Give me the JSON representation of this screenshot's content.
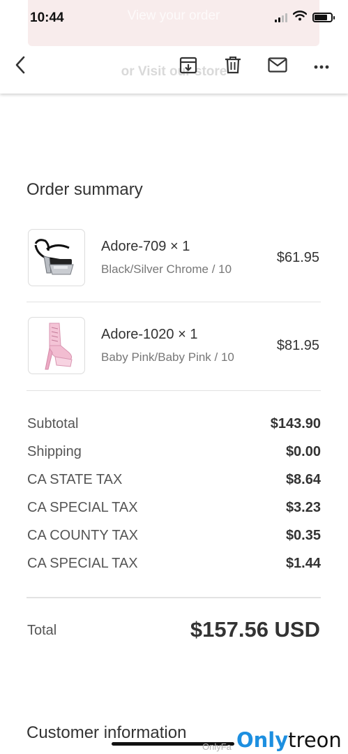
{
  "status_bar": {
    "time": "10:44"
  },
  "overlay": {
    "banner_text": "View your order",
    "ghost_link_text": "or Visit our store"
  },
  "toolbar": {
    "back_icon": "chevron-left-icon",
    "archive_icon": "archive-icon",
    "delete_icon": "trash-icon",
    "mail_icon": "mail-icon",
    "more_icon": "more-icon"
  },
  "order_summary": {
    "title": "Order summary",
    "items": [
      {
        "name": "Adore-709 × 1",
        "variant": "Black/Silver Chrome / 10",
        "price": "$61.95"
      },
      {
        "name": "Adore-1020 × 1",
        "variant": "Baby Pink/Baby Pink / 10",
        "price": "$81.95"
      }
    ],
    "lines": [
      {
        "label": "Subtotal",
        "value": "$143.90"
      },
      {
        "label": "Shipping",
        "value": "$0.00"
      },
      {
        "label": "CA STATE TAX",
        "value": "$8.64"
      },
      {
        "label": "CA SPECIAL TAX",
        "value": "$3.23"
      },
      {
        "label": "CA COUNTY TAX",
        "value": "$0.35"
      },
      {
        "label": "CA SPECIAL TAX",
        "value": "$1.44"
      }
    ],
    "total_label": "Total",
    "total_value": "$157.56 USD"
  },
  "customer_information": {
    "title": "Customer information"
  },
  "watermark": {
    "small": "OnlyFa",
    "brand_a": "Only",
    "brand_b": "treon"
  },
  "colors": {
    "banner": "#f8ecec",
    "brand_blue": "#1d8fe0",
    "divider": "#e2e2e2"
  }
}
